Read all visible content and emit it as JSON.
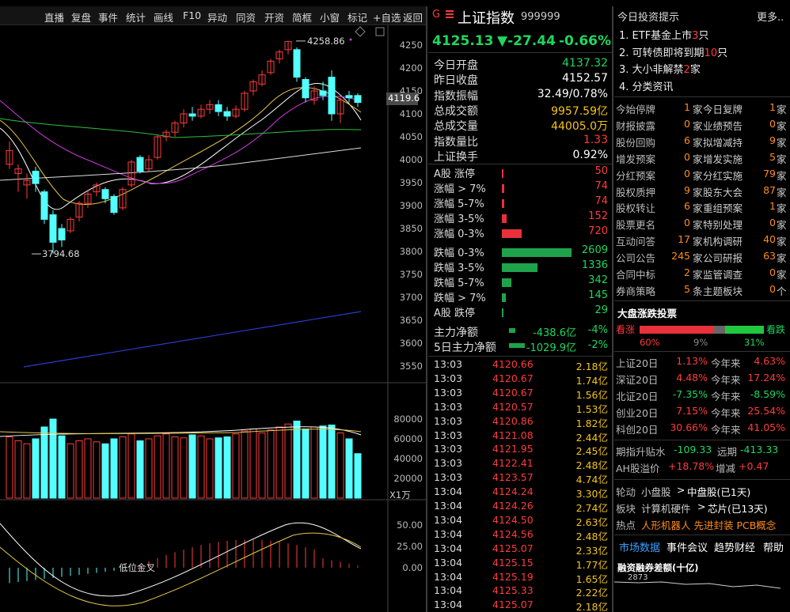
{
  "toolbar": {
    "items": [
      "直播",
      "复盘",
      "事件",
      "统计",
      "画线",
      "F10",
      "异动",
      "同资",
      "开资",
      "简框",
      "小窗",
      "标记",
      "+自选",
      "返回"
    ]
  },
  "chart": {
    "price_axis": [
      "4250",
      "4200",
      "4150",
      "4100",
      "4050",
      "4000",
      "3950",
      "3900",
      "3850",
      "3800",
      "3750",
      "3700",
      "3650",
      "3600",
      "3550"
    ],
    "current_price_tag": "4119.6",
    "high_label": "4258.86",
    "low_label": "3794.68",
    "volume_axis": [
      "80000",
      "60000",
      "40000",
      "20000"
    ],
    "volume_unit": "X1万",
    "macd_axis": [
      "50.00",
      "25.00",
      "0.00"
    ],
    "macd_annotation": "低位金叉"
  },
  "chart_data": {
    "type": "candlestick",
    "ylim": [
      3550,
      4270
    ],
    "candles": [
      [
        3990,
        4020,
        3980,
        4040
      ],
      [
        3970,
        3980,
        3930,
        3990
      ],
      [
        3945,
        3955,
        3915,
        3970
      ],
      [
        3975,
        3948,
        3930,
        3985
      ],
      [
        3930,
        3870,
        3860,
        3935
      ],
      [
        3880,
        3820,
        3795,
        3890
      ],
      [
        3850,
        3825,
        3810,
        3860
      ],
      [
        3845,
        3870,
        3840,
        3875
      ],
      [
        3875,
        3905,
        3865,
        3910
      ],
      [
        3905,
        3925,
        3895,
        3935
      ],
      [
        3930,
        3945,
        3920,
        3950
      ],
      [
        3935,
        3915,
        3905,
        3940
      ],
      [
        3920,
        3885,
        3880,
        3925
      ],
      [
        3895,
        3935,
        3890,
        3940
      ],
      [
        3945,
        3995,
        3940,
        4000
      ],
      [
        4005,
        3975,
        3970,
        4010
      ],
      [
        3980,
        4000,
        3975,
        4010
      ],
      [
        4005,
        4050,
        4000,
        4055
      ],
      [
        4050,
        4060,
        4040,
        4065
      ],
      [
        4060,
        4080,
        4050,
        4085
      ],
      [
        4080,
        4100,
        4070,
        4110
      ],
      [
        4100,
        4095,
        4085,
        4115
      ],
      [
        4095,
        4110,
        4090,
        4120
      ],
      [
        4110,
        4120,
        4100,
        4130
      ],
      [
        4120,
        4105,
        4095,
        4130
      ],
      [
        4105,
        4095,
        4085,
        4115
      ],
      [
        4095,
        4110,
        4090,
        4118
      ],
      [
        4110,
        4145,
        4105,
        4150
      ],
      [
        4150,
        4170,
        4140,
        4175
      ],
      [
        4165,
        4185,
        4160,
        4195
      ],
      [
        4190,
        4215,
        4185,
        4220
      ],
      [
        4220,
        4235,
        4210,
        4240
      ],
      [
        4240,
        4258,
        4230,
        4259
      ],
      [
        4240,
        4180,
        4170,
        4245
      ],
      [
        4175,
        4135,
        4125,
        4180
      ],
      [
        4130,
        4150,
        4120,
        4160
      ],
      [
        4150,
        4140,
        4130,
        4170
      ],
      [
        4180,
        4100,
        4085,
        4195
      ],
      [
        4100,
        4130,
        4080,
        4135
      ],
      [
        4140,
        4135,
        4125,
        4150
      ],
      [
        4140,
        4125,
        4115,
        4145
      ]
    ],
    "volumes": [
      62,
      58,
      55,
      60,
      72,
      80,
      63,
      55,
      58,
      60,
      57,
      55,
      60,
      62,
      65,
      58,
      60,
      63,
      65,
      62,
      61,
      64,
      63,
      60,
      61,
      62,
      65,
      68,
      70,
      66,
      69,
      72,
      75,
      78,
      70,
      72,
      73,
      74,
      66,
      60,
      45
    ]
  },
  "index": {
    "flag": "G",
    "name": "上证指数",
    "code": "999999",
    "price": "4125.13",
    "change": "▼-27.44",
    "pct": "-0.66%"
  },
  "stats": [
    {
      "label": "今日开盘",
      "value": "4137.32",
      "cls": "grn"
    },
    {
      "label": "昨日收盘",
      "value": "4152.57",
      "cls": "wht"
    },
    {
      "label": "指数振幅",
      "value": "32.49/0.78%",
      "cls": "wht"
    },
    {
      "label": "总成交额",
      "value": "9957.59亿",
      "cls": "yel"
    },
    {
      "label": "总成交量",
      "value": "44005.0万",
      "cls": "yel"
    },
    {
      "label": "指数量比",
      "value": "1.33",
      "cls": "red"
    },
    {
      "label": "上证换手",
      "value": "0.92%",
      "cls": "wht"
    }
  ],
  "dist": [
    {
      "label": "A股 涨停",
      "value": "50",
      "cls": "red",
      "w": 2,
      "color": "#e8313b"
    },
    {
      "label": "涨幅 > 7%",
      "value": "74",
      "cls": "red",
      "w": 3,
      "color": "#e8313b"
    },
    {
      "label": "涨幅 5-7%",
      "value": "74",
      "cls": "red",
      "w": 3,
      "color": "#e8313b"
    },
    {
      "label": "涨幅 3-5%",
      "value": "152",
      "cls": "red",
      "w": 6,
      "color": "#e8313b"
    },
    {
      "label": "涨幅 0-3%",
      "value": "720",
      "cls": "red",
      "w": 25,
      "color": "#e8313b"
    },
    {
      "label": "跌幅 0-3%",
      "value": "2609",
      "cls": "grn",
      "w": 88,
      "color": "#1fa34a"
    },
    {
      "label": "跌幅 3-5%",
      "value": "1336",
      "cls": "grn",
      "w": 45,
      "color": "#1fa34a"
    },
    {
      "label": "跌幅 5-7%",
      "value": "342",
      "cls": "grn",
      "w": 12,
      "color": "#1fa34a"
    },
    {
      "label": "跌幅 > 7%",
      "value": "145",
      "cls": "grn",
      "w": 5,
      "color": "#1fa34a"
    },
    {
      "label": "A股 跌停",
      "value": "29",
      "cls": "grn",
      "w": 2,
      "color": "#1fa34a"
    }
  ],
  "flow": [
    {
      "label": "主力净额",
      "value": "-438.6亿",
      "pct": "-4%"
    },
    {
      "label": "5日主力净额",
      "value": "-1029.9亿",
      "pct": "-2%"
    }
  ],
  "ticks": [
    [
      "13:03",
      "4120.66",
      "2.18亿"
    ],
    [
      "13:03",
      "4120.67",
      "1.74亿"
    ],
    [
      "13:03",
      "4120.67",
      "1.56亿"
    ],
    [
      "13:03",
      "4120.57",
      "1.53亿"
    ],
    [
      "13:03",
      "4120.86",
      "1.82亿"
    ],
    [
      "13:03",
      "4121.08",
      "2.44亿"
    ],
    [
      "13:03",
      "4121.95",
      "2.45亿"
    ],
    [
      "13:03",
      "4122.41",
      "2.48亿"
    ],
    [
      "13:03",
      "4123.57",
      "4.74亿"
    ],
    [
      "13:04",
      "4124.24",
      "3.30亿"
    ],
    [
      "13:04",
      "4124.26",
      "2.74亿"
    ],
    [
      "13:04",
      "4124.50",
      "2.63亿"
    ],
    [
      "13:04",
      "4124.56",
      "2.48亿"
    ],
    [
      "13:04",
      "4125.07",
      "2.33亿"
    ],
    [
      "13:04",
      "4125.15",
      "1.77亿"
    ],
    [
      "13:04",
      "4125.19",
      "1.65亿"
    ],
    [
      "13:04",
      "4125.33",
      "2.22亿"
    ],
    [
      "13:04",
      "4125.07",
      "2.18亿"
    ]
  ],
  "tips": {
    "title": "今日投资提示",
    "more": "更多..",
    "items": [
      [
        "1. ETF基金上市",
        "3",
        "只"
      ],
      [
        "2. 可转债即将到期",
        "10",
        "只"
      ],
      [
        "3. 大小非解禁",
        "2",
        "家"
      ],
      [
        "4. 分类资讯",
        "",
        ""
      ]
    ]
  },
  "events": [
    [
      "今始停牌",
      "1",
      "家",
      "今日复牌",
      "1",
      "家"
    ],
    [
      "财报披露",
      "0",
      "家",
      "业绩预告",
      "0",
      "家"
    ],
    [
      "股份回购",
      "6",
      "家",
      "拟增减持",
      "9",
      "家"
    ],
    [
      "增发预案",
      "0",
      "家",
      "增发实施",
      "5",
      "家"
    ],
    [
      "分红预案",
      "0",
      "家",
      "分红实施",
      "79",
      "家"
    ],
    [
      "股权质押",
      "9",
      "家",
      "股东大会",
      "87",
      "家"
    ],
    [
      "股权转让",
      "6",
      "家",
      "重组预案",
      "1",
      "家"
    ],
    [
      "股票更名",
      "0",
      "家",
      "特别处理",
      "0",
      "家"
    ],
    [
      "互动问答",
      "17",
      "家",
      "机构调研",
      "40",
      "家"
    ],
    [
      "公司公告",
      "245",
      "家",
      "公司研报",
      "63",
      "家"
    ],
    [
      "合同中标",
      "2",
      "家",
      "监管调查",
      "0",
      "家"
    ],
    [
      "券商策略",
      "5",
      "条",
      "主题板块",
      "0",
      "个"
    ]
  ],
  "vote": {
    "title": "大盘涨跌投票",
    "up": "看涨",
    "down": "看跌",
    "up_pct": "60%",
    "flat_pct": "9%",
    "down_pct": "31%",
    "up_frac": 0.6,
    "flat_frac": 0.09,
    "down_frac": 0.31
  },
  "perf": [
    [
      "上证20日",
      "1.13%",
      "今年来",
      "4.63%",
      "red",
      "red"
    ],
    [
      "深证20日",
      "4.48%",
      "今年来",
      "17.24%",
      "red",
      "red"
    ],
    [
      "北证20日",
      "-7.35%",
      "今年来",
      "-8.59%",
      "grn",
      "grn"
    ],
    [
      "创业20日",
      "7.15%",
      "今年来",
      "25.54%",
      "red",
      "red"
    ],
    [
      "科创20日",
      "30.66%",
      "今年来",
      "41.05%",
      "red",
      "red"
    ]
  ],
  "misc": {
    "futures_label": "期指升贴水",
    "futures_val": "-109.33",
    "far_label": "远期",
    "far_val": "-413.33",
    "ah_label": "AH股溢价",
    "ah_val": "+18.78%",
    "inc_label": "增减",
    "inc_val": "+0.47",
    "rot_label": "轮动",
    "rot_from": "小盘股",
    "rot_to": "中盘股(已1天)",
    "sector_label": "板块",
    "sector_from": "计算机硬件",
    "sector_to": "芯片(已13天)",
    "hot_label": "热点",
    "hot_val": "人形机器人 先进封装 PCB概念",
    "tabs": [
      "市场数据",
      "事件会议",
      "趋势财经",
      "帮助"
    ],
    "margin_title": "融资融券差额(十亿)",
    "margin_val": "2873"
  }
}
